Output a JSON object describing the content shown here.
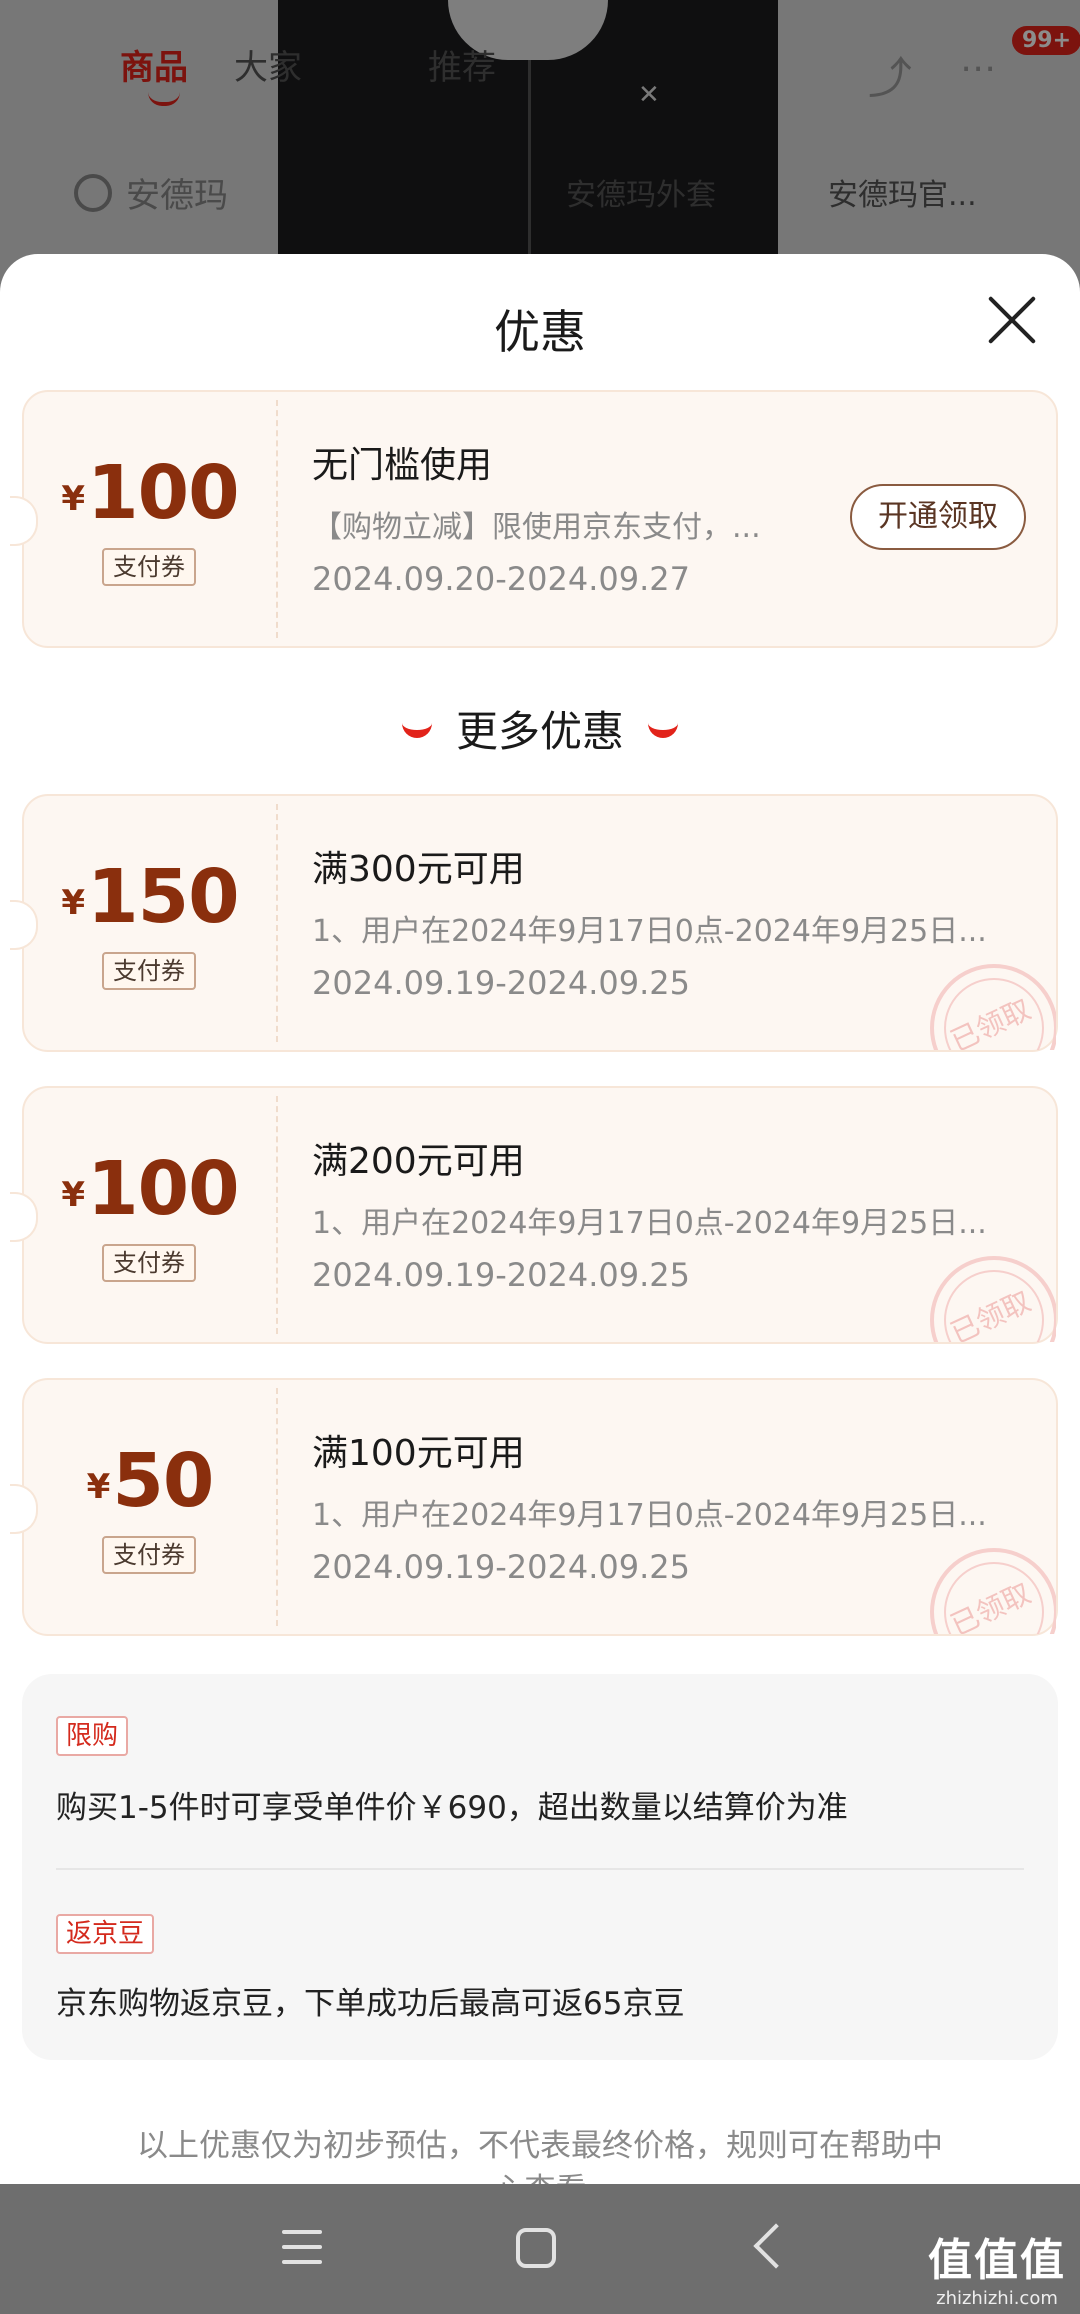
{
  "background": {
    "tabs": [
      "商品",
      "大家",
      "推荐"
    ],
    "badge": "99+",
    "search_text": "安德玛",
    "chips": [
      "安德玛外套",
      "安德玛官..."
    ]
  },
  "sheet": {
    "title": "优惠",
    "top_coupon": {
      "currency": "¥",
      "amount": "100",
      "tag": "支付券",
      "title": "无门槛使用",
      "desc": "【购物立减】限使用京东支付，...",
      "date": "2024.09.20-2024.09.27",
      "button": "开通领取"
    },
    "more_title": "更多优惠",
    "coupons": [
      {
        "currency": "¥",
        "amount": "150",
        "tag": "支付券",
        "title": "满300元可用",
        "desc": "1、用户在2024年9月17日0点-2024年9月25日...",
        "date": "2024.09.19-2024.09.25",
        "stamp": "已领取"
      },
      {
        "currency": "¥",
        "amount": "100",
        "tag": "支付券",
        "title": "满200元可用",
        "desc": "1、用户在2024年9月17日0点-2024年9月25日...",
        "date": "2024.09.19-2024.09.25",
        "stamp": "已领取"
      },
      {
        "currency": "¥",
        "amount": "50",
        "tag": "支付券",
        "title": "满100元可用",
        "desc": "1、用户在2024年9月17日0点-2024年9月25日...",
        "date": "2024.09.19-2024.09.25",
        "stamp": "已领取"
      }
    ],
    "info": {
      "limit_tag": "限购",
      "limit_text": "购买1-5件时可享受单件价￥690，超出数量以结算价为准",
      "bean_tag": "返京豆",
      "bean_text": "京东购物返京豆，下单成功后最高可返65京豆"
    },
    "footnote": "以上优惠仅为初步预估，不代表最终价格，规则可在帮助中心查看"
  },
  "watermark": {
    "big": "值值值",
    "small": "zhizhizhi.com"
  },
  "colors": {
    "accent": "#e2231a",
    "amount": "#8a2f0d",
    "coupon_bg": "#fdf7f2"
  }
}
